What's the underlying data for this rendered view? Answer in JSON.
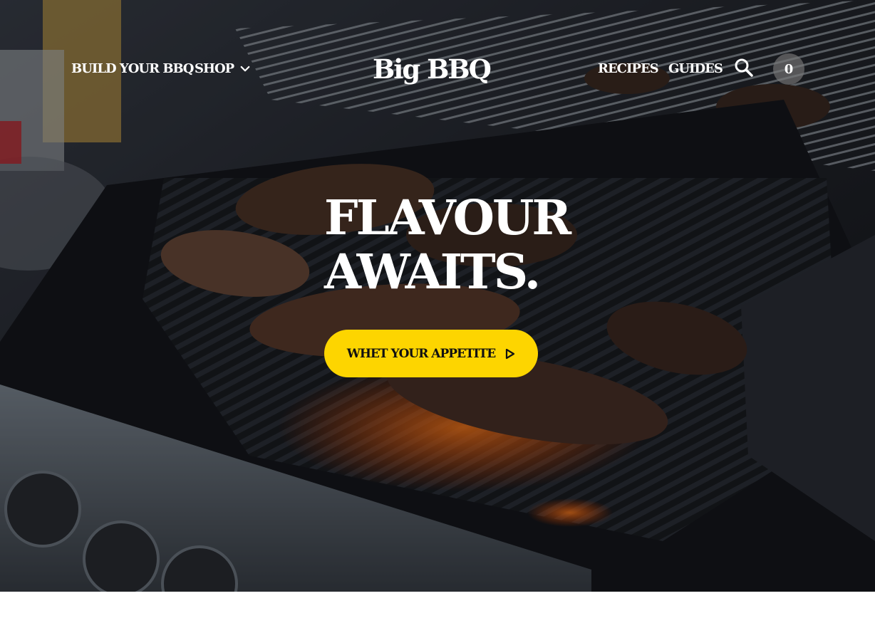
{
  "nav": {
    "left_items": [
      {
        "label": "BUILD YOUR BBQ"
      },
      {
        "label": "SHOP",
        "icon": "chevron-down-icon"
      }
    ],
    "logo": "Big BBQ",
    "right_items": [
      {
        "label": "RECIPES"
      },
      {
        "label": "GUIDES"
      }
    ],
    "search_icon": "search-icon",
    "cart_count": "0"
  },
  "hero": {
    "headline_line1": "FLAVOUR",
    "headline_line2": "AWAITS.",
    "cta_label": "WHET YOUR APPETITE",
    "cta_icon": "play-icon"
  },
  "colors": {
    "accent": "#fdd500",
    "text_on_dark": "#ffffff",
    "cart_bg": "#7a7a7a"
  }
}
